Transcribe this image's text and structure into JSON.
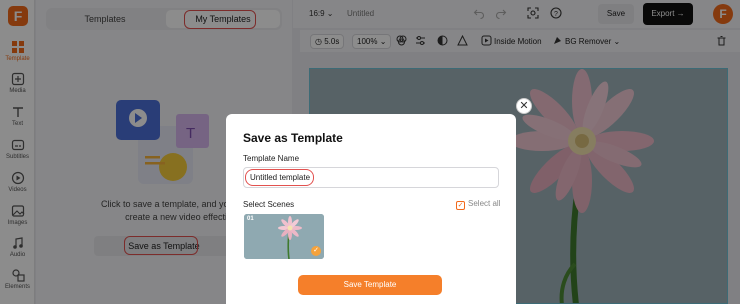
{
  "app": {
    "logo_letter": "F",
    "project_title": "Untitled",
    "aspect": "16:9"
  },
  "rail": {
    "items": [
      {
        "label": "Template",
        "icon": "template-icon"
      },
      {
        "label": "Media",
        "icon": "media-icon"
      },
      {
        "label": "Text",
        "icon": "text-icon"
      },
      {
        "label": "Subtitles",
        "icon": "subtitles-icon"
      },
      {
        "label": "Videos",
        "icon": "video-icon"
      },
      {
        "label": "Images",
        "icon": "image-icon"
      },
      {
        "label": "Audio",
        "icon": "audio-icon"
      },
      {
        "label": "Elements",
        "icon": "elements-icon"
      }
    ]
  },
  "panel": {
    "tabs": [
      {
        "label": "Templates"
      },
      {
        "label": "My Templates"
      }
    ],
    "message_line1": "Click to save a template, and you can re-e",
    "message_line2": "create a new video effectively.",
    "save_as_template": "Save as Template"
  },
  "topbar": {
    "save": "Save",
    "export": "Export"
  },
  "subbar": {
    "duration": "5.0s",
    "zoom": "100%",
    "inside_motion": "Inside Motion",
    "bg_remover": "BG Remover"
  },
  "modal": {
    "title": "Save as Template",
    "name_label": "Template Name",
    "name_value": "Untitled template",
    "scenes_label": "Select Scenes",
    "select_all": "Select all",
    "scene_number": "01",
    "save_button": "Save Template"
  },
  "colors": {
    "accent": "#f26a1b",
    "highlight": "#e2514f",
    "canvas_bg": "#9eb3bb"
  }
}
